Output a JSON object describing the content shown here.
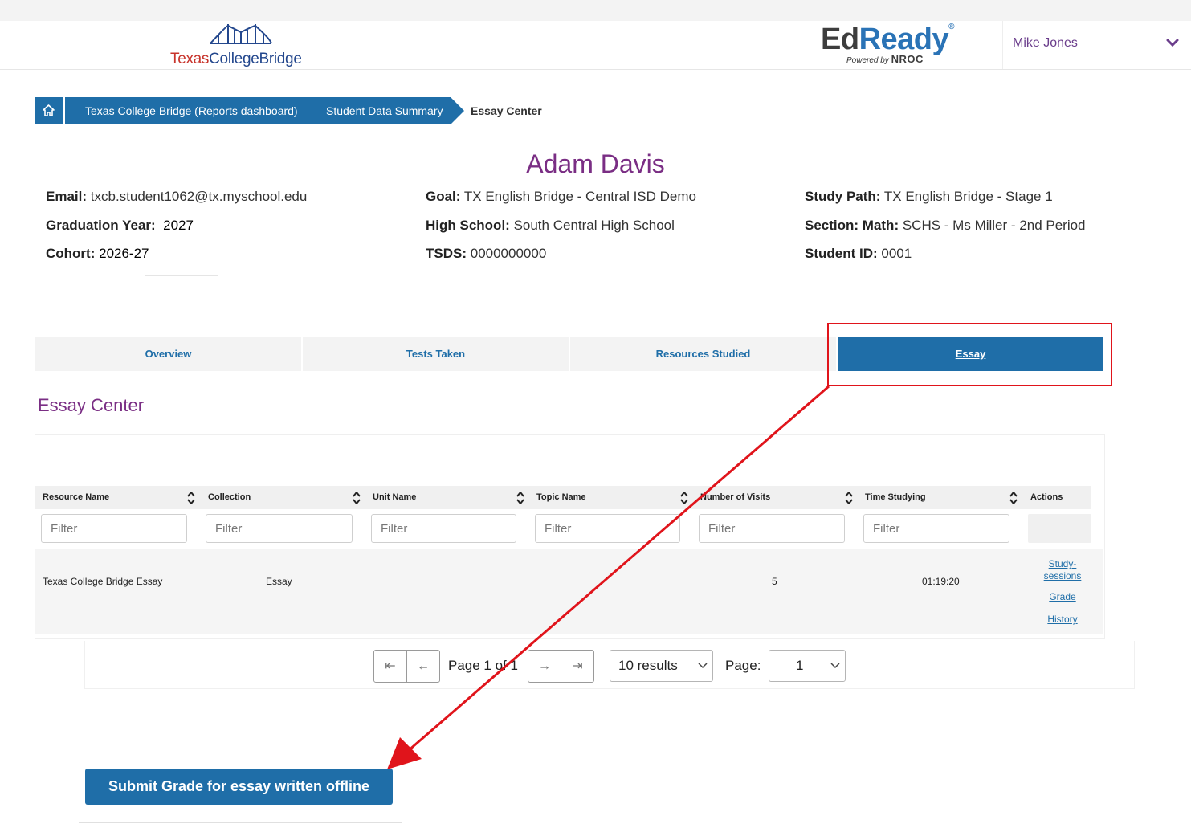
{
  "header": {
    "logo_left_a": "Texas",
    "logo_left_b": "CollegeBridge",
    "logo_right_a": "Ed",
    "logo_right_b": "Ready",
    "logo_right_tm": "®",
    "powered_by": "Powered by",
    "powered_brand": "NROC",
    "user_name": "Mike Jones"
  },
  "breadcrumb": {
    "items": [
      "Texas College Bridge (Reports dashboard)",
      "Student Data Summary"
    ],
    "current": "Essay Center"
  },
  "student": {
    "name": "Adam Davis",
    "fields": [
      {
        "label": "Email:",
        "value": "txcb.student1062@tx.myschool.edu"
      },
      {
        "label": "Goal:",
        "value": "TX English Bridge - Central ISD Demo"
      },
      {
        "label": "Study Path:",
        "value": "TX English Bridge - Stage 1"
      },
      {
        "label": "Graduation Year:",
        "value": "2027"
      },
      {
        "label": "High School:",
        "value": "South Central High School"
      },
      {
        "label": "Section: Math:",
        "value": "SCHS - Ms Miller - 2nd Period"
      },
      {
        "label": "Cohort:",
        "value": "2026-27"
      },
      {
        "label": "TSDS:",
        "value": "0000000000"
      },
      {
        "label": "Student ID:",
        "value": "0001"
      }
    ]
  },
  "tabs": [
    "Overview",
    "Tests Taken",
    "Resources Studied",
    "Essay"
  ],
  "active_tab": "Essay",
  "section_title": "Essay Center",
  "table": {
    "columns": [
      "Resource Name",
      "Collection",
      "Unit Name",
      "Topic Name",
      "Number of Visits",
      "Time Studying",
      "Actions"
    ],
    "filter_placeholder": "Filter",
    "rows": [
      {
        "resource": "Texas College Bridge Essay",
        "collection": "Essay",
        "unit": "",
        "topic": "",
        "visits": "5",
        "time": "01:19:20",
        "actions": [
          "Study-sessions",
          "Grade",
          "History"
        ]
      }
    ],
    "action_study_line1": "Study-",
    "action_study_line2": "sessions"
  },
  "pagination": {
    "page_text": "Page 1 of 1",
    "results_option": "10 results",
    "page_label": "Page:",
    "page_value": "1",
    "first": "⇤",
    "prev": "←",
    "next": "→",
    "last": "⇥"
  },
  "submit_button": "Submit Grade for essay written offline",
  "colors": {
    "brand_blue": "#1f6ea8",
    "brand_purple": "#7a2e84",
    "annotation_red": "#e0141b"
  }
}
